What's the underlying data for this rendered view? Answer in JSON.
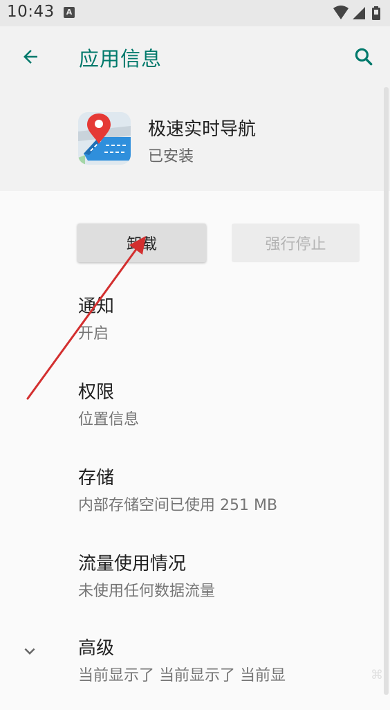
{
  "status_bar": {
    "time": "10:43",
    "badge": "A"
  },
  "app_bar": {
    "title": "应用信息",
    "back_icon": "arrow-back-icon",
    "search_icon": "search-icon"
  },
  "app": {
    "name": "极速实时导航",
    "status": "已安装",
    "icon": "navigation-app-icon"
  },
  "buttons": {
    "uninstall_label": "卸载",
    "force_stop_label": "强行停止"
  },
  "items": [
    {
      "title": "通知",
      "summary": "开启"
    },
    {
      "title": "权限",
      "summary": "位置信息"
    },
    {
      "title": "存储",
      "summary": "内部存储空间已使用 251 MB"
    },
    {
      "title": "流量使用情况",
      "summary": "未使用任何数据流量"
    },
    {
      "title": "高级",
      "summary": "当前显示了 当前显示了 当前显"
    }
  ],
  "colors": {
    "accent": "#00796b",
    "annotation_arrow": "#d32f2f"
  }
}
